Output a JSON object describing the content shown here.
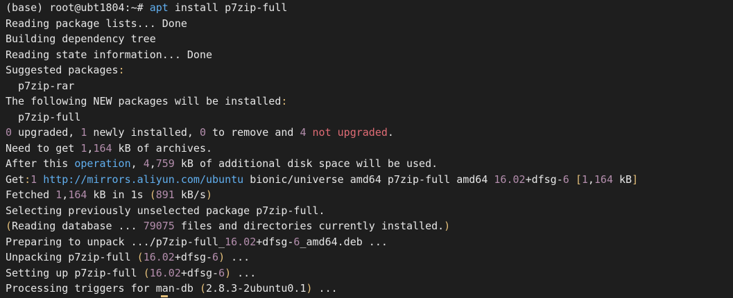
{
  "terminal": {
    "prompt": "(base) root@ubt1804:~#",
    "command": "apt install p7zip-full",
    "lines": [
      {
        "segments": [
          {
            "t": "Reading package lists... Done",
            "c": ""
          }
        ]
      },
      {
        "segments": [
          {
            "t": "Building dependency tree",
            "c": ""
          }
        ]
      },
      {
        "segments": [
          {
            "t": "Reading state information... Done",
            "c": ""
          }
        ]
      },
      {
        "segments": [
          {
            "t": "Suggested packages",
            "c": ""
          },
          {
            "t": ":",
            "c": "yellow"
          }
        ]
      },
      {
        "segments": [
          {
            "t": "  p7zip-rar",
            "c": ""
          }
        ]
      },
      {
        "segments": [
          {
            "t": "The following NEW packages will be installed",
            "c": ""
          },
          {
            "t": ":",
            "c": "yellow"
          }
        ]
      },
      {
        "segments": [
          {
            "t": "  p7zip-full",
            "c": ""
          }
        ]
      },
      {
        "segments": [
          {
            "t": "0",
            "c": "num"
          },
          {
            "t": " upgraded, ",
            "c": ""
          },
          {
            "t": "1",
            "c": "num"
          },
          {
            "t": " newly installed, ",
            "c": ""
          },
          {
            "t": "0",
            "c": "num"
          },
          {
            "t": " to remove and ",
            "c": ""
          },
          {
            "t": "4",
            "c": "num"
          },
          {
            "t": " ",
            "c": ""
          },
          {
            "t": "not upgraded",
            "c": "red"
          },
          {
            "t": ".",
            "c": ""
          }
        ]
      },
      {
        "segments": [
          {
            "t": "Need to get ",
            "c": ""
          },
          {
            "t": "1",
            "c": "num"
          },
          {
            "t": ",",
            "c": ""
          },
          {
            "t": "164",
            "c": "num"
          },
          {
            "t": " kB of archives.",
            "c": ""
          }
        ]
      },
      {
        "segments": [
          {
            "t": "After this ",
            "c": ""
          },
          {
            "t": "operation",
            "c": "blue"
          },
          {
            "t": ", ",
            "c": ""
          },
          {
            "t": "4",
            "c": "num"
          },
          {
            "t": ",",
            "c": ""
          },
          {
            "t": "759",
            "c": "num"
          },
          {
            "t": " kB of additional disk space will be used.",
            "c": ""
          }
        ]
      },
      {
        "segments": [
          {
            "t": "Get",
            "c": ""
          },
          {
            "t": ":",
            "c": "yellow"
          },
          {
            "t": "1",
            "c": "num"
          },
          {
            "t": " ",
            "c": ""
          },
          {
            "t": "http://mirrors.aliyun.com/ubuntu",
            "c": "blue"
          },
          {
            "t": " bionic/universe amd64 p7zip-full amd64 ",
            "c": ""
          },
          {
            "t": "16.02",
            "c": "num"
          },
          {
            "t": "+dfsg-",
            "c": ""
          },
          {
            "t": "6",
            "c": "num"
          },
          {
            "t": " ",
            "c": ""
          },
          {
            "t": "[",
            "c": "yellow"
          },
          {
            "t": "1",
            "c": "num"
          },
          {
            "t": ",",
            "c": ""
          },
          {
            "t": "164",
            "c": "num"
          },
          {
            "t": " kB",
            "c": ""
          },
          {
            "t": "]",
            "c": "yellow"
          }
        ]
      },
      {
        "segments": [
          {
            "t": "Fetched ",
            "c": ""
          },
          {
            "t": "1",
            "c": "num"
          },
          {
            "t": ",",
            "c": ""
          },
          {
            "t": "164",
            "c": "num"
          },
          {
            "t": " kB in ",
            "c": ""
          },
          {
            "t": "1s",
            "c": ""
          },
          {
            "t": " ",
            "c": ""
          },
          {
            "t": "(",
            "c": "yellow"
          },
          {
            "t": "891",
            "c": "num"
          },
          {
            "t": " kB/s",
            "c": ""
          },
          {
            "t": ")",
            "c": "yellow"
          }
        ]
      },
      {
        "segments": [
          {
            "t": "Selecting previously unselected package p7zip-full.",
            "c": ""
          }
        ]
      },
      {
        "segments": [
          {
            "t": "(",
            "c": "yellow"
          },
          {
            "t": "Reading database ... ",
            "c": ""
          },
          {
            "t": "79075",
            "c": "num"
          },
          {
            "t": " files and directories currently installed.",
            "c": ""
          },
          {
            "t": ")",
            "c": "yellow"
          }
        ]
      },
      {
        "segments": [
          {
            "t": "Preparing to unpack .../p7zip-full_",
            "c": ""
          },
          {
            "t": "16.02",
            "c": "num"
          },
          {
            "t": "+dfsg-",
            "c": ""
          },
          {
            "t": "6",
            "c": "num"
          },
          {
            "t": "_amd64.deb ...",
            "c": ""
          }
        ]
      },
      {
        "segments": [
          {
            "t": "Unpacking p7zip-full ",
            "c": ""
          },
          {
            "t": "(",
            "c": "yellow"
          },
          {
            "t": "16.02",
            "c": "num"
          },
          {
            "t": "+dfsg-",
            "c": ""
          },
          {
            "t": "6",
            "c": "num"
          },
          {
            "t": ")",
            "c": "yellow"
          },
          {
            "t": " ...",
            "c": ""
          }
        ]
      },
      {
        "segments": [
          {
            "t": "Setting up p7zip-full ",
            "c": ""
          },
          {
            "t": "(",
            "c": "yellow"
          },
          {
            "t": "16.02",
            "c": "num"
          },
          {
            "t": "+dfsg-",
            "c": ""
          },
          {
            "t": "6",
            "c": "num"
          },
          {
            "t": ")",
            "c": "yellow"
          },
          {
            "t": " ...",
            "c": ""
          }
        ]
      },
      {
        "segments": [
          {
            "t": "Processing triggers for man-db ",
            "c": ""
          },
          {
            "t": "(",
            "c": "yellow"
          },
          {
            "t": "2.8.3-2ubuntu0.1",
            "c": ""
          },
          {
            "t": ")",
            "c": "yellow"
          },
          {
            "t": " ...",
            "c": ""
          }
        ]
      }
    ]
  },
  "colors": {
    "background": "#1e1e1e",
    "foreground": "#e6e6e6",
    "number": "#b48ead",
    "link": "#61afef",
    "warning": "#e06c75",
    "punct": "#e5c07b"
  }
}
